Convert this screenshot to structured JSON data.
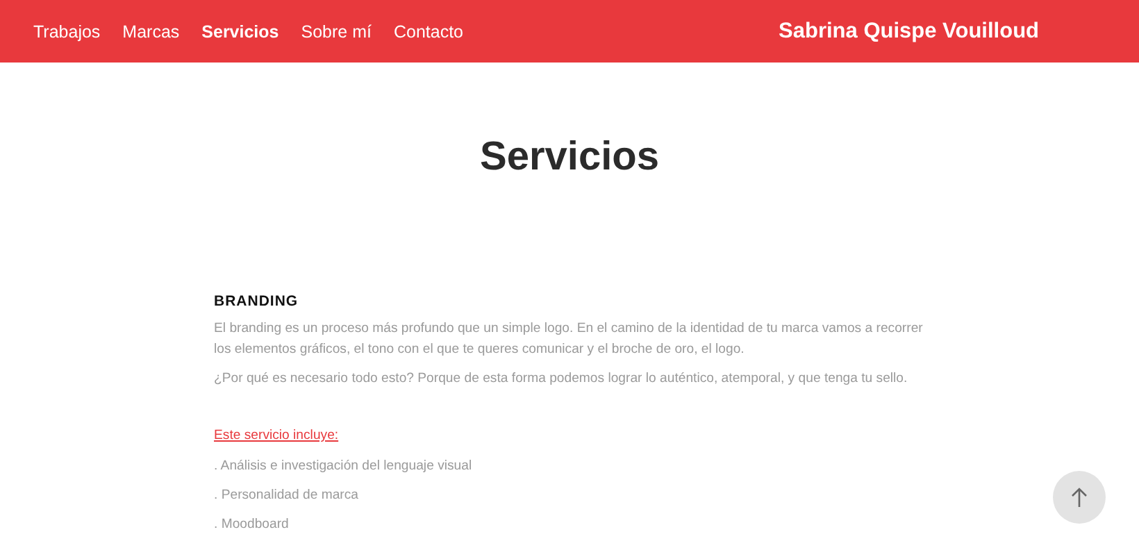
{
  "nav": {
    "links": [
      {
        "label": "Trabajos",
        "selected": false
      },
      {
        "label": "Marcas",
        "selected": false
      },
      {
        "label": "Servicios",
        "selected": true
      },
      {
        "label": "Sobre mí",
        "selected": false
      },
      {
        "label": "Contacto",
        "selected": false
      }
    ],
    "brand": "Sabrina Quispe Vouilloud"
  },
  "page_title": "Servicios",
  "section": {
    "heading": "BRANDING",
    "paragraphs": [
      "El branding es un proceso más profundo que un simple logo. En el camino de la identidad de tu marca vamos a recorrer los elementos gráficos, el tono con el que te queres comunicar y el broche de oro, el logo.",
      "¿Por qué es necesario todo esto? Porque de esta forma podemos lograr lo auténtico, atemporal, y que tenga tu sello."
    ],
    "includes_link": "Este servicio incluye:",
    "items": [
      ". Análisis e investigación del lenguaje visual",
      ". Personalidad de marca",
      ". Moodboard"
    ]
  }
}
